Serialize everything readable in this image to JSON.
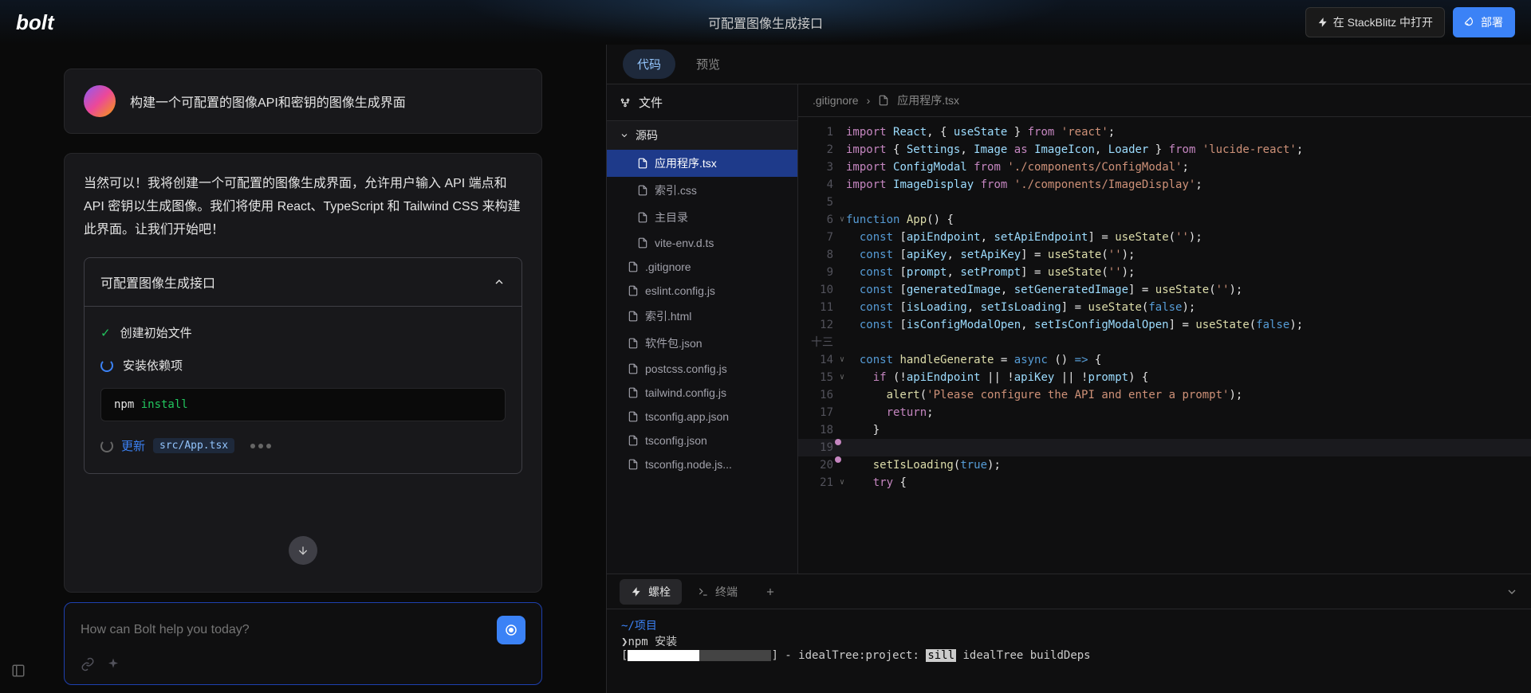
{
  "header": {
    "logo": "bolt",
    "title": "可配置图像生成接口",
    "open_btn": "在 StackBlitz 中打开",
    "deploy_btn": "部署"
  },
  "chat": {
    "user_prompt": "构建一个可配置的图像API和密钥的图像生成界面",
    "response": "当然可以！我将创建一个可配置的图像生成界面，允许用户输入 API 端点和 API 密钥以生成图像。我们将使用 React、TypeScript 和 Tailwind CSS 来构建此界面。让我们开始吧！",
    "task_title": "可配置图像生成接口",
    "step1": "创建初始文件",
    "step2": "安装依赖项",
    "cmd_prefix": "npm ",
    "cmd": "install",
    "update_label": "更新",
    "update_file": "src/App.tsx",
    "input_placeholder": "How can Bolt help you today?"
  },
  "tabs": {
    "code": "代码",
    "preview": "预览"
  },
  "filetree": {
    "header": "文件",
    "folder": "源码",
    "files_src": [
      "应用程序.tsx",
      "索引.css",
      "主目录",
      "vite-env.d.ts"
    ],
    "files_root": [
      ".gitignore",
      "eslint.config.js",
      "索引.html",
      "软件包.json",
      "postcss.config.js",
      "tailwind.config.js",
      "tsconfig.app.json",
      "tsconfig.json",
      "tsconfig.node.js..."
    ]
  },
  "breadcrumb": {
    "part1": ".gitignore",
    "part2": "应用程序.tsx"
  },
  "code_lines": [
    {
      "n": "1",
      "html": "<span class='c-kw'>import</span> <span class='c-var'>React</span>, { <span class='c-var'>useState</span> } <span class='c-kw'>from</span> <span class='c-str'>'react'</span>;"
    },
    {
      "n": "2",
      "html": "<span class='c-kw'>import</span> { <span class='c-var'>Settings</span>, <span class='c-var'>Image</span> <span class='c-kw'>as</span> <span class='c-var'>ImageIcon</span>, <span class='c-var'>Loader</span> } <span class='c-kw'>from</span> <span class='c-str'>'lucide-react'</span>;"
    },
    {
      "n": "3",
      "html": "<span class='c-kw'>import</span> <span class='c-var'>ConfigModal</span> <span class='c-kw'>from</span> <span class='c-str'>'./components/ConfigModal'</span>;"
    },
    {
      "n": "4",
      "html": "<span class='c-kw'>import</span> <span class='c-var'>ImageDisplay</span> <span class='c-kw'>from</span> <span class='c-str'>'./components/ImageDisplay'</span>;"
    },
    {
      "n": "5",
      "html": ""
    },
    {
      "n": "6",
      "fold": "∨",
      "html": "<span class='c-fn'>function</span> <span class='c-call'>App</span>() {"
    },
    {
      "n": "7",
      "html": "  <span class='c-fn'>const</span> [<span class='c-var'>apiEndpoint</span>, <span class='c-var'>setApiEndpoint</span>] = <span class='c-call'>useState</span>(<span class='c-str'>''</span>);"
    },
    {
      "n": "8",
      "html": "  <span class='c-fn'>const</span> [<span class='c-var'>apiKey</span>, <span class='c-var'>setApiKey</span>] = <span class='c-call'>useState</span>(<span class='c-str'>''</span>);"
    },
    {
      "n": "9",
      "html": "  <span class='c-fn'>const</span> [<span class='c-var'>prompt</span>, <span class='c-var'>setPrompt</span>] = <span class='c-call'>useState</span>(<span class='c-str'>''</span>);"
    },
    {
      "n": "10",
      "html": "  <span class='c-fn'>const</span> [<span class='c-var'>generatedImage</span>, <span class='c-var'>setGeneratedImage</span>] = <span class='c-call'>useState</span>(<span class='c-str'>''</span>);"
    },
    {
      "n": "11",
      "html": "  <span class='c-fn'>const</span> [<span class='c-var'>isLoading</span>, <span class='c-var'>setIsLoading</span>] = <span class='c-call'>useState</span>(<span class='c-bool'>false</span>);"
    },
    {
      "n": "12",
      "html": "  <span class='c-fn'>const</span> [<span class='c-var'>isConfigModalOpen</span>, <span class='c-var'>setIsConfigModalOpen</span>] = <span class='c-call'>useState</span>(<span class='c-bool'>false</span>);"
    },
    {
      "n": "十三",
      "html": ""
    },
    {
      "n": "14",
      "fold": "∨",
      "html": "  <span class='c-fn'>const</span> <span class='c-call'>handleGenerate</span> = <span class='c-fn'>async</span> () <span class='c-fn'>=&gt;</span> {"
    },
    {
      "n": "15",
      "fold": "∨",
      "html": "    <span class='c-kw'>if</span> (!<span class='c-var'>apiEndpoint</span> || !<span class='c-var'>apiKey</span> || !<span class='c-var'>prompt</span>) {"
    },
    {
      "n": "16",
      "html": "      <span class='c-call'>alert</span>(<span class='c-str'>'Please configure the API and enter a prompt'</span>);"
    },
    {
      "n": "17",
      "html": "      <span class='c-kw'>return</span>;"
    },
    {
      "n": "18",
      "html": "    }"
    },
    {
      "n": "19",
      "hl": true,
      "dot": true,
      "html": ""
    },
    {
      "n": "20",
      "dot": true,
      "html": "    <span class='c-call'>setIsLoading</span>(<span class='c-bool'>true</span>);"
    },
    {
      "n": "21",
      "fold": "∨",
      "html": "    <span class='c-kw'>try</span> {"
    }
  ],
  "terminal": {
    "tab1": "螺栓",
    "tab2": "终端",
    "path": "~/项目",
    "cmd": "npm 安装",
    "out_prefix": "[",
    "out_mid": "] - idealTree:project: ",
    "out_sill": "sill",
    "out_rest": " idealTree buildDeps"
  }
}
